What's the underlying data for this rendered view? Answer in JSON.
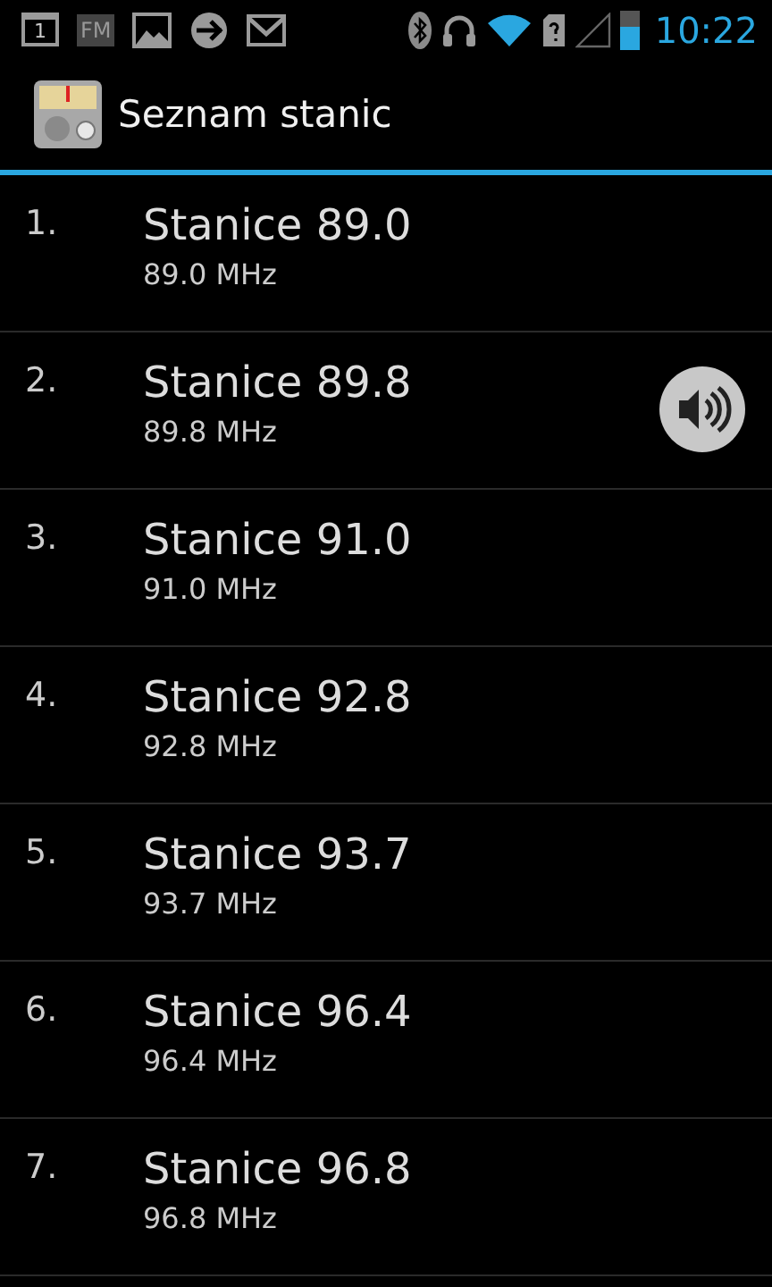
{
  "status_bar": {
    "calendar_day": "1",
    "fm_label": "FM",
    "time": "10:22"
  },
  "action_bar": {
    "title": "Seznam stanic"
  },
  "stations": [
    {
      "number": "1.",
      "name": "Stanice 89.0",
      "frequency": "89.0 MHz",
      "playing": false
    },
    {
      "number": "2.",
      "name": "Stanice 89.8",
      "frequency": "89.8 MHz",
      "playing": true
    },
    {
      "number": "3.",
      "name": "Stanice 91.0",
      "frequency": "91.0 MHz",
      "playing": false
    },
    {
      "number": "4.",
      "name": "Stanice 92.8",
      "frequency": "92.8 MHz",
      "playing": false
    },
    {
      "number": "5.",
      "name": "Stanice 93.7",
      "frequency": "93.7 MHz",
      "playing": false
    },
    {
      "number": "6.",
      "name": "Stanice 96.4",
      "frequency": "96.4 MHz",
      "playing": false
    },
    {
      "number": "7.",
      "name": "Stanice 96.8",
      "frequency": "96.8 MHz",
      "playing": false
    }
  ]
}
